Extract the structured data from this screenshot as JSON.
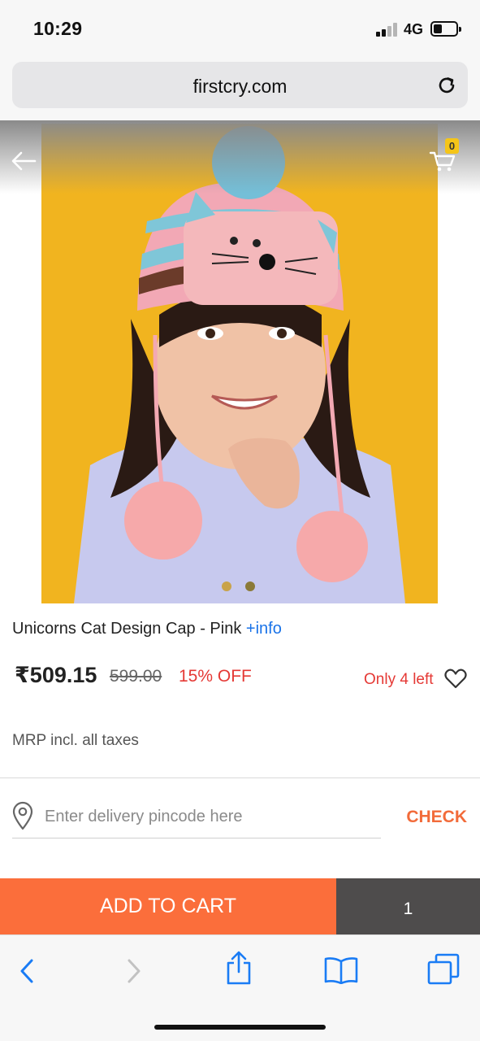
{
  "status_bar": {
    "time": "10:29",
    "network": "4G"
  },
  "browser": {
    "url": "firstcry.com"
  },
  "header": {
    "cart_count": "0"
  },
  "product": {
    "title": "Unicorns Cat Design Cap - Pink",
    "info_link": "+info",
    "currency_symbol": "₹",
    "price": "509.15",
    "mrp": "599.00",
    "discount": "15% OFF",
    "stock_note": "Only 4 left",
    "tax_note": "MRP incl. all taxes",
    "image_count": 2,
    "active_image_index": 2
  },
  "delivery": {
    "pincode_placeholder": "Enter delivery pincode here",
    "pincode_value": "",
    "check_label": "CHECK"
  },
  "cart_bar": {
    "add_label": "ADD TO CART",
    "quantity": "1"
  },
  "colors": {
    "accent": "#fb6e3b",
    "discount_red": "#e53935",
    "link_blue": "#1a73e8",
    "safari_blue": "#1a7cf5",
    "photo_background": "#f1b41f"
  }
}
